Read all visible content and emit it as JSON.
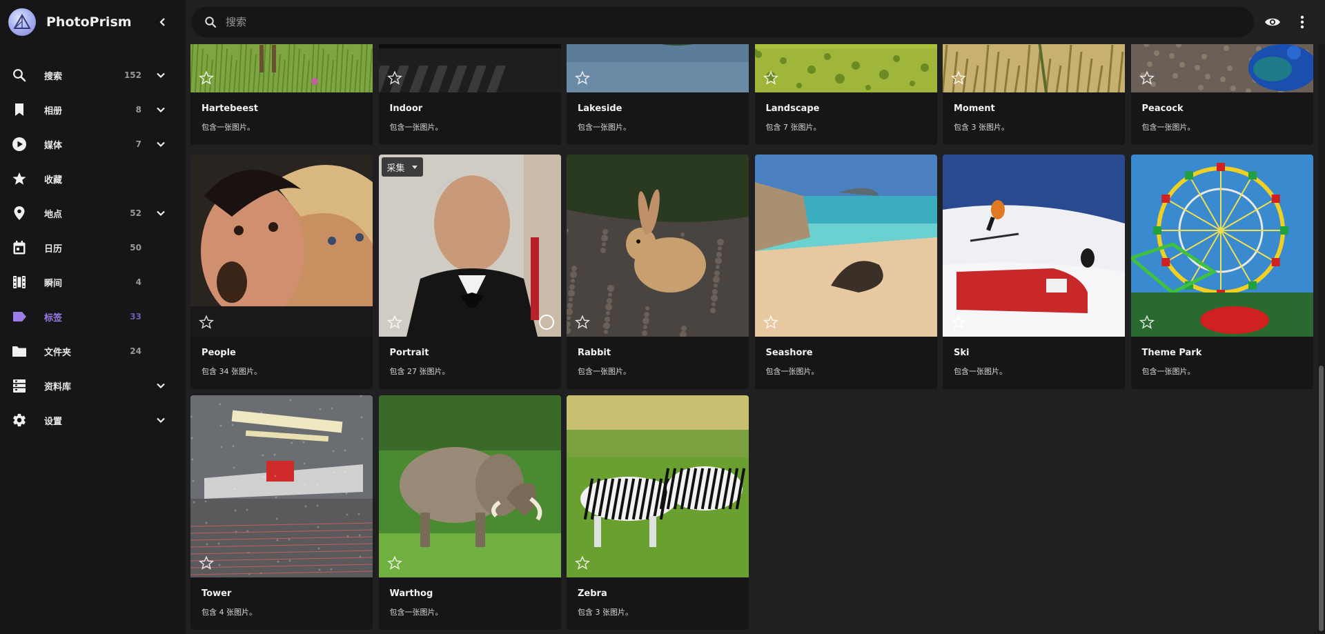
{
  "app": {
    "name": "PhotoPrism"
  },
  "search": {
    "placeholder": "搜索"
  },
  "sidebar": {
    "items": [
      {
        "label": "搜索",
        "count": "152",
        "icon": "search-icon",
        "expand": true
      },
      {
        "label": "相册",
        "count": "8",
        "icon": "bookmark-icon",
        "expand": true
      },
      {
        "label": "媒体",
        "count": "7",
        "icon": "play-circle-icon",
        "expand": true
      },
      {
        "label": "收藏",
        "count": "",
        "icon": "star-icon",
        "expand": false
      },
      {
        "label": "地点",
        "count": "52",
        "icon": "map-marker-icon",
        "expand": true
      },
      {
        "label": "日历",
        "count": "50",
        "icon": "calendar-icon",
        "expand": false
      },
      {
        "label": "瞬间",
        "count": "4",
        "icon": "film-icon",
        "expand": false
      },
      {
        "label": "标签",
        "count": "33",
        "icon": "label-icon",
        "expand": false,
        "active": true
      },
      {
        "label": "文件夹",
        "count": "24",
        "icon": "folder-icon",
        "expand": false
      },
      {
        "label": "资料库",
        "count": "",
        "icon": "library-icon",
        "expand": true
      },
      {
        "label": "设置",
        "count": "",
        "icon": "gear-icon",
        "expand": true
      }
    ]
  },
  "labels": [
    {
      "title": "Hartebeest",
      "subtitle": "包含一张图片。"
    },
    {
      "title": "Indoor",
      "subtitle": "包含一张图片。"
    },
    {
      "title": "Lakeside",
      "subtitle": "包含一张图片。"
    },
    {
      "title": "Landscape",
      "subtitle": "包含 7 张图片。"
    },
    {
      "title": "Moment",
      "subtitle": "包含 3 张图片。"
    },
    {
      "title": "Peacock",
      "subtitle": "包含一张图片。"
    },
    {
      "title": "People",
      "subtitle": "包含 34 张图片。"
    },
    {
      "title": "Portrait",
      "subtitle": "包含 27 张图片。",
      "chip": "采集",
      "selectable": true
    },
    {
      "title": "Rabbit",
      "subtitle": "包含一张图片。"
    },
    {
      "title": "Seashore",
      "subtitle": "包含一张图片。"
    },
    {
      "title": "Ski",
      "subtitle": "包含一张图片。"
    },
    {
      "title": "Theme Park",
      "subtitle": "包含一张图片。"
    },
    {
      "title": "Tower",
      "subtitle": "包含 4 张图片。"
    },
    {
      "title": "Warthog",
      "subtitle": "包含一张图片。"
    },
    {
      "title": "Zebra",
      "subtitle": "包含 3 张图片。"
    }
  ],
  "colors": {
    "accent": "#9b7ce8",
    "background": "#202023",
    "sidebar": "#161618",
    "card": "#161618"
  }
}
